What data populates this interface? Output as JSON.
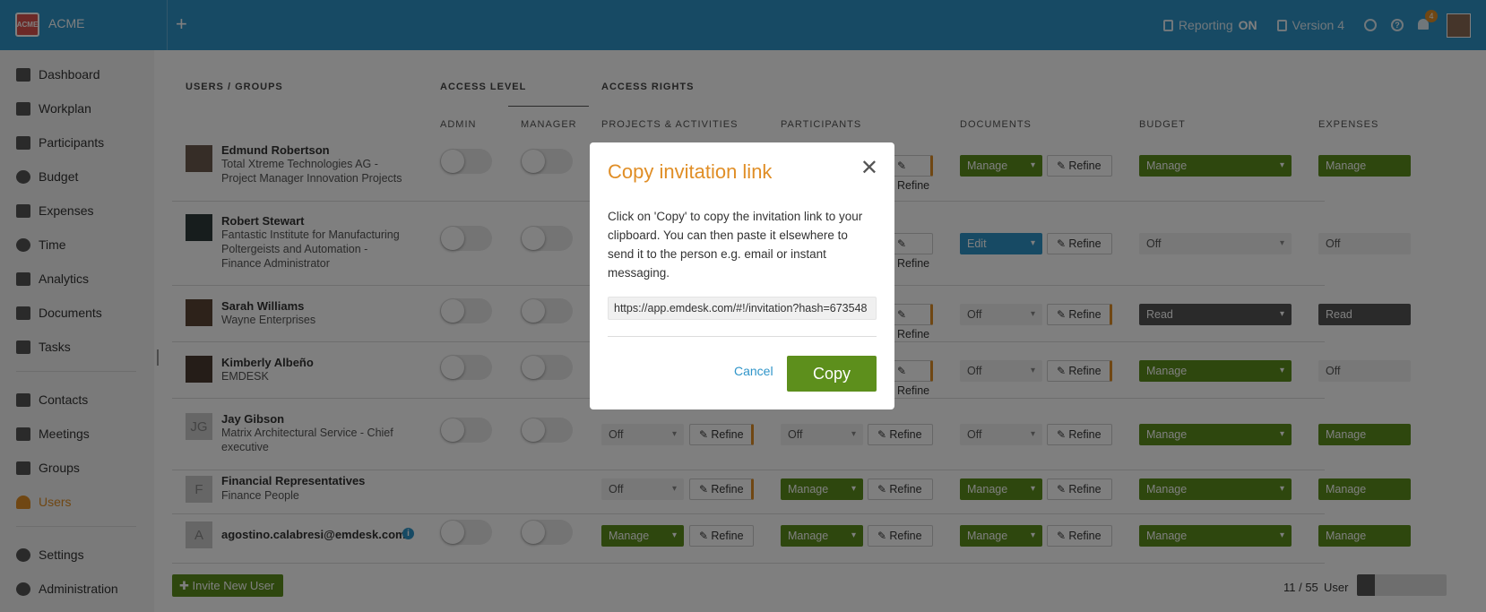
{
  "app": {
    "logo_text": "ACME",
    "name": "ACME"
  },
  "topbar": {
    "reporting_label": "Reporting",
    "reporting_state": "ON",
    "version_label": "Version 4",
    "notification_count": "4"
  },
  "sidebar": {
    "items": [
      {
        "label": "Dashboard",
        "icon": "dashboard-icon"
      },
      {
        "label": "Workplan",
        "icon": "workplan-icon"
      },
      {
        "label": "Participants",
        "icon": "participants-icon"
      },
      {
        "label": "Budget",
        "icon": "budget-icon"
      },
      {
        "label": "Expenses",
        "icon": "expenses-icon"
      },
      {
        "label": "Time",
        "icon": "clock-icon"
      },
      {
        "label": "Analytics",
        "icon": "analytics-icon"
      },
      {
        "label": "Documents",
        "icon": "documents-icon"
      },
      {
        "label": "Tasks",
        "icon": "tasks-icon"
      },
      {
        "label": "Contacts",
        "icon": "contacts-icon"
      },
      {
        "label": "Meetings",
        "icon": "meetings-icon"
      },
      {
        "label": "Groups",
        "icon": "groups-icon"
      },
      {
        "label": "Users",
        "icon": "user-icon"
      },
      {
        "label": "Settings",
        "icon": "gear-icon"
      },
      {
        "label": "Administration",
        "icon": "admin-gear-icon"
      }
    ]
  },
  "table": {
    "header_users": "USERS / GROUPS",
    "header_access_level": "ACCESS LEVEL",
    "header_access_rights": "ACCESS RIGHTS",
    "col_admin": "ADMIN",
    "col_manager": "MANAGER",
    "col_projects": "PROJECTS & ACTIVITIES",
    "col_participants": "PARTICIPANTS",
    "col_documents": "DOCUMENTS",
    "col_budget": "BUDGET",
    "col_expenses": "EXPENSES",
    "refine_label": "Refine",
    "rows": [
      {
        "name": "Edmund Robertson",
        "org1": "Total Xtreme Technologies AG -",
        "org2": "Project Manager Innovation Projects",
        "org3": "",
        "documents": "Manage",
        "budget": "Manage",
        "expenses": "Manage"
      },
      {
        "name": "Robert Stewart",
        "org1": "Fantastic Institute for Manufacturing",
        "org2": "Poltergeists and Automation -",
        "org3": "Finance Administrator",
        "documents": "Edit",
        "budget": "Off",
        "expenses": "Off"
      },
      {
        "name": "Sarah Williams",
        "org1": "Wayne Enterprises",
        "org2": "",
        "org3": "",
        "documents": "Off",
        "budget": "Read",
        "expenses": "Read"
      },
      {
        "name": "Kimberly Albeño",
        "org1": "EMDESK",
        "org2": "",
        "org3": "",
        "documents": "Off",
        "budget": "Manage",
        "expenses": "Off"
      },
      {
        "name": "Jay Gibson",
        "initials": "JG",
        "org1": "Matrix Architectural Service - Chief",
        "org2": "executive",
        "org3": "",
        "projects": "Off",
        "participants": "Off",
        "documents": "Off",
        "budget": "Manage",
        "expenses": "Manage"
      },
      {
        "name": "Financial Representatives",
        "initials": "F",
        "org1": "Finance People",
        "org2": "",
        "org3": "",
        "projects": "Off",
        "participants": "Manage",
        "documents": "Manage",
        "budget": "Manage",
        "expenses": "Manage"
      },
      {
        "name": "agostino.calabresi@emdesk.com",
        "initials": "A",
        "org1": "",
        "org2": "",
        "org3": "",
        "projects": "Manage",
        "participants": "Manage",
        "documents": "Manage",
        "budget": "Manage",
        "expenses": "Manage"
      }
    ]
  },
  "footer": {
    "invite_label": "Invite New User",
    "pager_text": "11 / 55",
    "pager_label": "User"
  },
  "modal": {
    "title": "Copy invitation link",
    "text": "Click on 'Copy' to copy the invitation link to your clipboard. You can then paste it elsewhere to send it to the person e.g. email or instant messaging.",
    "link": "https://app.emdesk.com/#!/invitation?hash=673548",
    "cancel_label": "Cancel",
    "copy_label": "Copy"
  },
  "colors": {
    "topbar": "#2f95c9",
    "accent": "#e08e26",
    "green": "#5d8f1c"
  }
}
